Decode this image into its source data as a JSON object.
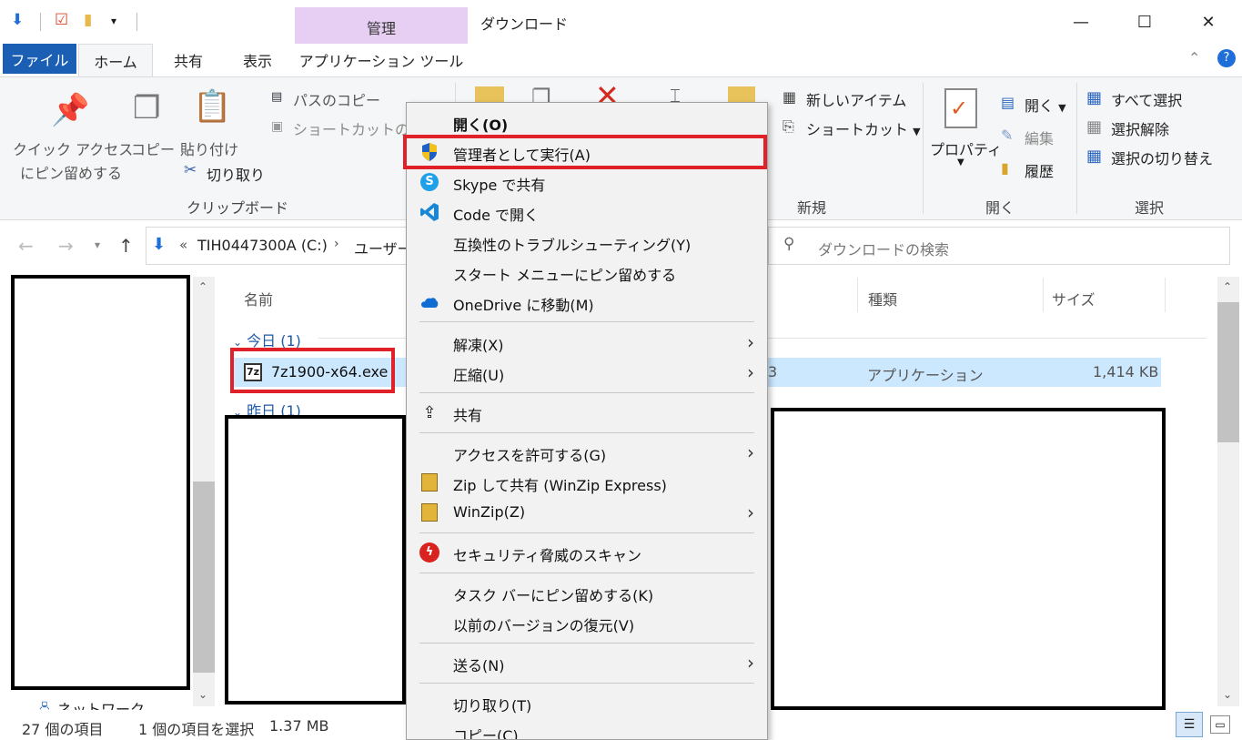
{
  "window": {
    "title": "ダウンロード",
    "context_tab_header": "管理",
    "minimize": "—",
    "maximize": "☐",
    "close": "✕"
  },
  "tabs": {
    "file": "ファイル",
    "home": "ホーム",
    "share": "共有",
    "view": "表示",
    "apptools": "アプリケーション ツール"
  },
  "ribbon": {
    "pin_quick_access_l1": "クイック アクセス",
    "pin_quick_access_l2": "にピン留めする",
    "copy": "コピー",
    "paste": "貼り付け",
    "copy_path": "パスのコピー",
    "paste_shortcut": "ショートカットの貼り",
    "cut": "切り取り",
    "group_clipboard": "クリップボード",
    "new_item": "新しいアイテム",
    "shortcut": "ショートカット",
    "group_new": "新規",
    "properties": "プロパティ",
    "open": "開く",
    "edit": "編集",
    "history": "履歴",
    "group_open": "開く",
    "select_all": "すべて選択",
    "select_none": "選択解除",
    "invert_selection": "選択の切り替え",
    "group_select": "選択"
  },
  "address": {
    "prefix": "«",
    "drive": "TIH0447300A (C:)",
    "users": "ユーザー",
    "search_placeholder": "ダウンロードの検索"
  },
  "columns": {
    "name": "名前",
    "type": "種類",
    "size": "サイズ"
  },
  "groups": {
    "today": "今日 (1)",
    "yesterday": "昨日 (1)"
  },
  "file": {
    "name": "7z1900-x64.exe",
    "type": "アプリケーション",
    "size": "1,414 KB",
    "date_fragment": "3"
  },
  "nav_pane": {
    "network": "ネットワーク"
  },
  "status": {
    "count": "27 個の項目",
    "selection": "1 個の項目を選択",
    "size": "1.37 MB"
  },
  "context_menu": [
    {
      "label": "開く(O)",
      "bold": true
    },
    {
      "label": "管理者として実行(A)",
      "icon": "uac-shield-icon"
    },
    {
      "label": "Skype で共有",
      "icon": "skype-icon"
    },
    {
      "label": "Code で開く",
      "icon": "vscode-icon"
    },
    {
      "label": "互換性のトラブルシューティング(Y)"
    },
    {
      "label": "スタート メニューにピン留めする"
    },
    {
      "label": "OneDrive に移動(M)",
      "icon": "onedrive-icon"
    },
    {
      "label": "解凍(X)",
      "submenu": true
    },
    {
      "label": "圧縮(U)",
      "submenu": true
    },
    {
      "label": "共有",
      "icon": "share-icon"
    },
    {
      "label": "アクセスを許可する(G)",
      "submenu": true
    },
    {
      "label": "Zip して共有 (WinZip Express)",
      "icon": "winzip-icon"
    },
    {
      "label": "WinZip(Z)",
      "icon": "winzip-icon",
      "submenu": true
    },
    {
      "label": "セキュリティ脅威のスキャン",
      "icon": "trendmicro-icon"
    },
    {
      "label": "タスク バーにピン留めする(K)"
    },
    {
      "label": "以前のバージョンの復元(V)"
    },
    {
      "label": "送る(N)",
      "submenu": true
    },
    {
      "label": "切り取り(T)"
    },
    {
      "label": "コピー(C)"
    }
  ],
  "colors": {
    "file_tab": "#1a5fb4",
    "context_tab": "#e7cff4",
    "selection": "#cce8ff",
    "highlight_box": "#e0212a",
    "menu_bg": "#f2f2f2"
  }
}
